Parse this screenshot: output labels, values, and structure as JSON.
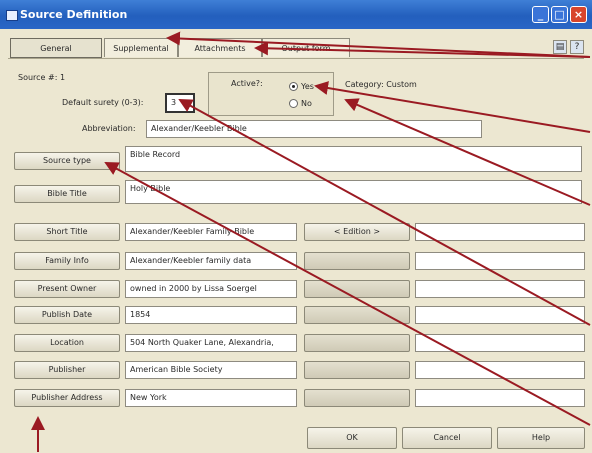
{
  "window": {
    "title": "Source Definition"
  },
  "tabs": [
    "General",
    "Supplemental",
    "Attachments",
    "Output form"
  ],
  "source_number_label": "Source #: 1",
  "surety": {
    "label": "Default surety (0-3):",
    "value": "3"
  },
  "active": {
    "label": "Active?:",
    "options": [
      "Yes",
      "No"
    ],
    "selected": "Yes"
  },
  "category_label": "Category: Custom",
  "abbreviation": {
    "label": "Abbreviation:",
    "value": "Alexander/Keebler Bible"
  },
  "source_type": {
    "button": "Source type",
    "value": "Bible Record"
  },
  "bible_title": {
    "button": "Bible Title",
    "value": "Holy Bible"
  },
  "rows": [
    {
      "button": "Short Title",
      "value": "Alexander/Keebler Family Bible",
      "right_button": "< Edition >"
    },
    {
      "button": "Family Info",
      "value": "Alexander/Keebler family data"
    },
    {
      "button": "Present Owner",
      "value": "owned in 2000 by Lissa Soergel"
    },
    {
      "button": "Publish Date",
      "value": "1854"
    },
    {
      "button": "Location",
      "value": "504 North Quaker Lane, Alexandria,"
    },
    {
      "button": "Publisher",
      "value": "American Bible Society"
    },
    {
      "button": "Publisher Address",
      "value": "New York"
    }
  ],
  "footer": {
    "ok": "OK",
    "cancel": "Cancel",
    "help": "Help"
  },
  "annotation_color": "#9a1a22"
}
